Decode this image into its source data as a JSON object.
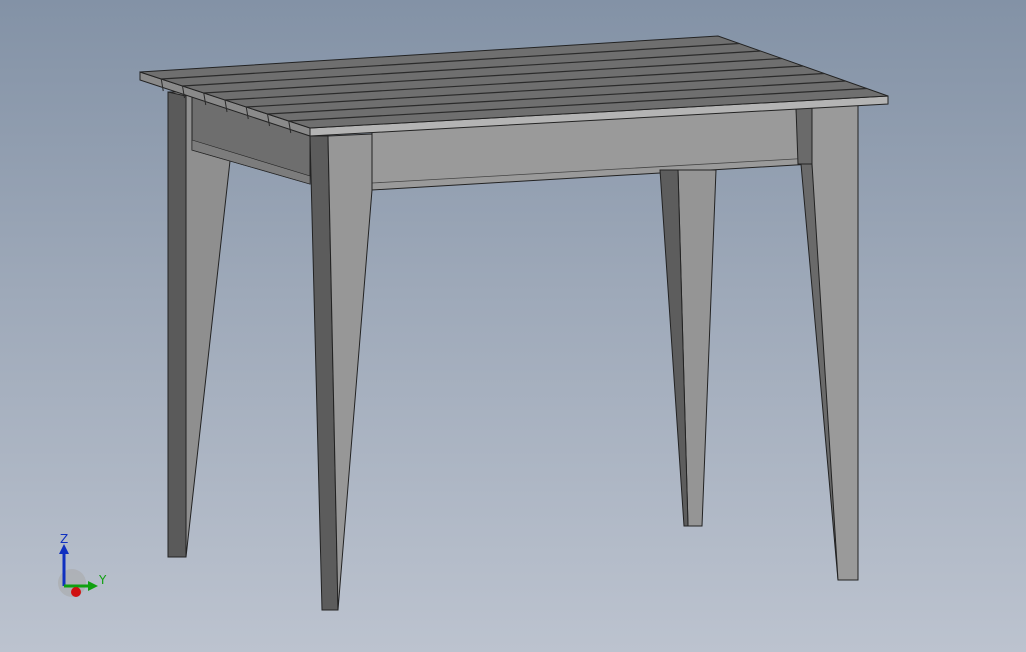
{
  "viewport": {
    "background_top": "#8392a6",
    "background_bottom": "#bcc3cf"
  },
  "model": {
    "name": "table",
    "slat_count": 8
  },
  "triad": {
    "x_label": "",
    "y_label": "Y",
    "z_label": "Z",
    "colors": {
      "x": "#d01010",
      "y": "#10a010",
      "z": "#1030c0"
    }
  }
}
